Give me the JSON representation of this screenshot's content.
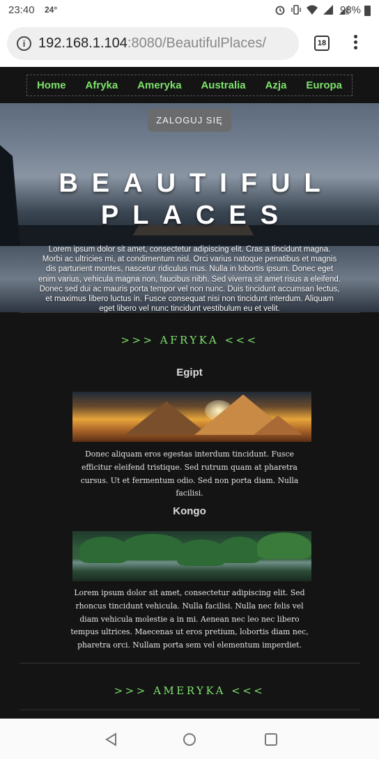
{
  "status_bar": {
    "time": "23:40",
    "temperature": "24°",
    "battery": "98%"
  },
  "browser": {
    "url_host": "192.168.1.104",
    "url_rest": ":8080/BeautifulPlaces/",
    "tab_count": "18"
  },
  "nav": {
    "items": [
      "Home",
      "Afryka",
      "Ameryka",
      "Australia",
      "Azja",
      "Europa"
    ]
  },
  "hero": {
    "login_label": "ZALOGUJ SIĘ",
    "title_line1": "BEAUTIFUL",
    "title_line2": "PLACES",
    "text": "Lorem ipsum dolor sit amet, consectetur adipiscing elit. Cras a tincidunt magna. Morbi ac ultricies mi, at condimentum nisl. Orci varius natoque penatibus et magnis dis parturient montes, nascetur ridiculus mus. Nulla in lobortis ipsum. Donec eget enim varius, vehicula magna non, faucibus nibh. Sed viverra sit amet risus a eleifend. Donec sed dui ac mauris porta tempor vel non nunc. Duis tincidunt accumsan lectus, et maximus libero luctus in. Fusce consequat nisi non tincidunt interdum. Aliquam eget libero vel nunc tincidunt vestibulum eu et velit."
  },
  "sections": [
    {
      "title": ">>> AFRYKA <<<",
      "places": [
        {
          "name": "Egipt",
          "text": "Donec aliquam eros egestas interdum tincidunt. Fusce efficitur eleifend tristique. Sed rutrum quam at pharetra cursus. Ut et fermentum odio. Sed non porta diam. Nulla facilisi."
        },
        {
          "name": "Kongo",
          "text": "Lorem ipsum dolor sit amet, consectetur adipiscing elit. Sed rhoncus tincidunt vehicula. Nulla facilisi. Nulla nec felis vel diam vehicula molestie a in mi. Aenean nec leo nec libero tempus ultrices. Maecenas ut eros pretium, lobortis diam nec, pharetra orci. Nullam porta sem vel elementum imperdiet."
        }
      ]
    },
    {
      "title": ">>> AMERYKA <<<"
    }
  ],
  "colors": {
    "accent": "#7ee36c",
    "page_bg": "#141414"
  }
}
